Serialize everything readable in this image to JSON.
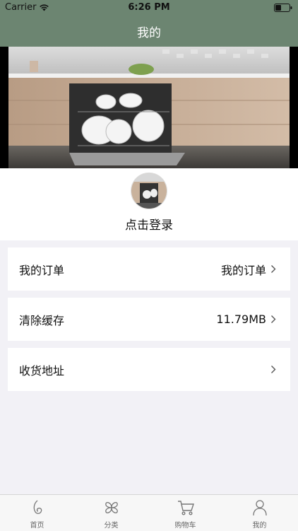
{
  "status_bar": {
    "carrier": "Carrier",
    "time": "6:26 PM"
  },
  "nav": {
    "title": "我的"
  },
  "profile": {
    "login_text": "点击登录"
  },
  "rows": [
    {
      "label": "我的订单",
      "value": "我的订单"
    },
    {
      "label": "清除缓存",
      "value": "11.79MB"
    },
    {
      "label": "收货地址",
      "value": ""
    }
  ],
  "tabs": [
    {
      "label": "首页",
      "icon": "home-icon"
    },
    {
      "label": "分类",
      "icon": "category-icon"
    },
    {
      "label": "购物车",
      "icon": "cart-icon"
    },
    {
      "label": "我的",
      "icon": "profile-icon"
    }
  ],
  "colors": {
    "theme": "#6c8571",
    "background": "#f2f1f6",
    "tab_active": "#333333"
  }
}
